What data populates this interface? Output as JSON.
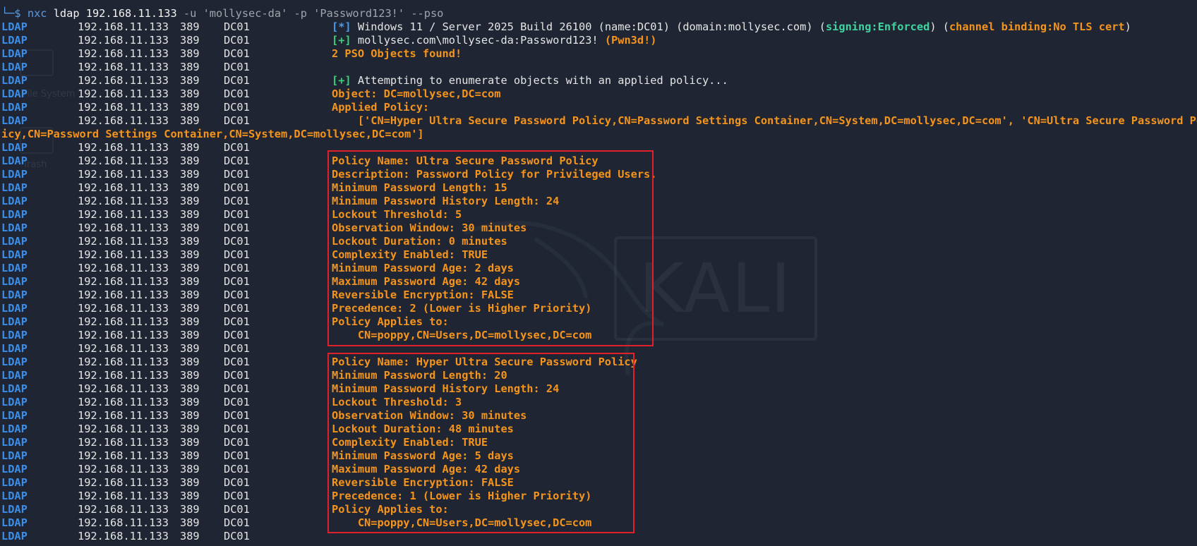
{
  "terminal": {
    "prompt_symbol": "└─$",
    "command": {
      "program": "nxc",
      "text": "ldap 192.168.11.133",
      "flag_u": "-u",
      "user": "'mollysec-da'",
      "flag_p": "-p",
      "pass": "'Password123!'",
      "flag_pso": "--pso"
    },
    "row_prefix": {
      "protocol": "LDAP",
      "ip": "192.168.11.133",
      "port": "389",
      "host": "DC01"
    },
    "header": {
      "tag_star": "[*]",
      "os_info": "Windows 11 / Server 2025 Build 26100 (name:DC01) (domain:mollysec.com) (",
      "signing": "signing:Enforced",
      "mid": ") (",
      "channel": "channel binding:No TLS cert",
      "end": ")",
      "tag_plus": "[+]",
      "auth": "mollysec.com\\mollysec-da:Password123!",
      "pwned": "(Pwn3d!)",
      "pso_count": "2 PSO Objects found!"
    },
    "enum": {
      "tag_plus": "[+]",
      "attempt": "Attempting to enumerate objects with an applied policy...",
      "object": "Object: DC=mollysec,DC=com",
      "applied": "Applied Policy:",
      "policy_list_1": "    ['CN=Hyper Ultra Secure Password Policy,CN=Password Settings Container,CN=System,DC=mollysec,DC=com', 'CN=Ultra Secure Password Pol",
      "policy_list_2": "icy,CN=Password Settings Container,CN=System,DC=mollysec,DC=com']"
    },
    "policy1": [
      "Policy Name: Ultra Secure Password Policy",
      "Description: Password Policy for Privileged Users.",
      "Minimum Password Length: 15",
      "Minimum Password History Length: 24",
      "Lockout Threshold: 5",
      "Observation Window: 30 minutes",
      "Lockout Duration: 0 minutes",
      "Complexity Enabled: TRUE",
      "Minimum Password Age: 2 days",
      "Maximum Password Age: 42 days",
      "Reversible Encryption: FALSE",
      "Precedence: 2 (Lower is Higher Priority)",
      "Policy Applies to:",
      "    CN=poppy,CN=Users,DC=mollysec,DC=com"
    ],
    "policy2": [
      "Policy Name: Hyper Ultra Secure Password Policy",
      "Minimum Password Length: 20",
      "Minimum Password History Length: 24",
      "Lockout Threshold: 3",
      "Observation Window: 30 minutes",
      "Lockout Duration: 48 minutes",
      "Complexity Enabled: TRUE",
      "Minimum Password Age: 5 days",
      "Maximum Password Age: 42 days",
      "Reversible Encryption: FALSE",
      "Precedence: 1 (Lower is Higher Priority)",
      "Policy Applies to:",
      "    CN=poppy,CN=Users,DC=mollysec,DC=com"
    ]
  },
  "background": {
    "logo_text": "KALI",
    "desktop_labels": [
      "File System",
      "Trash"
    ]
  },
  "colors": {
    "background": "#1f2532",
    "orange": "#f5941c",
    "blue": "#3b8eea",
    "green": "#3ecf7a",
    "red_box": "#e0202a"
  }
}
